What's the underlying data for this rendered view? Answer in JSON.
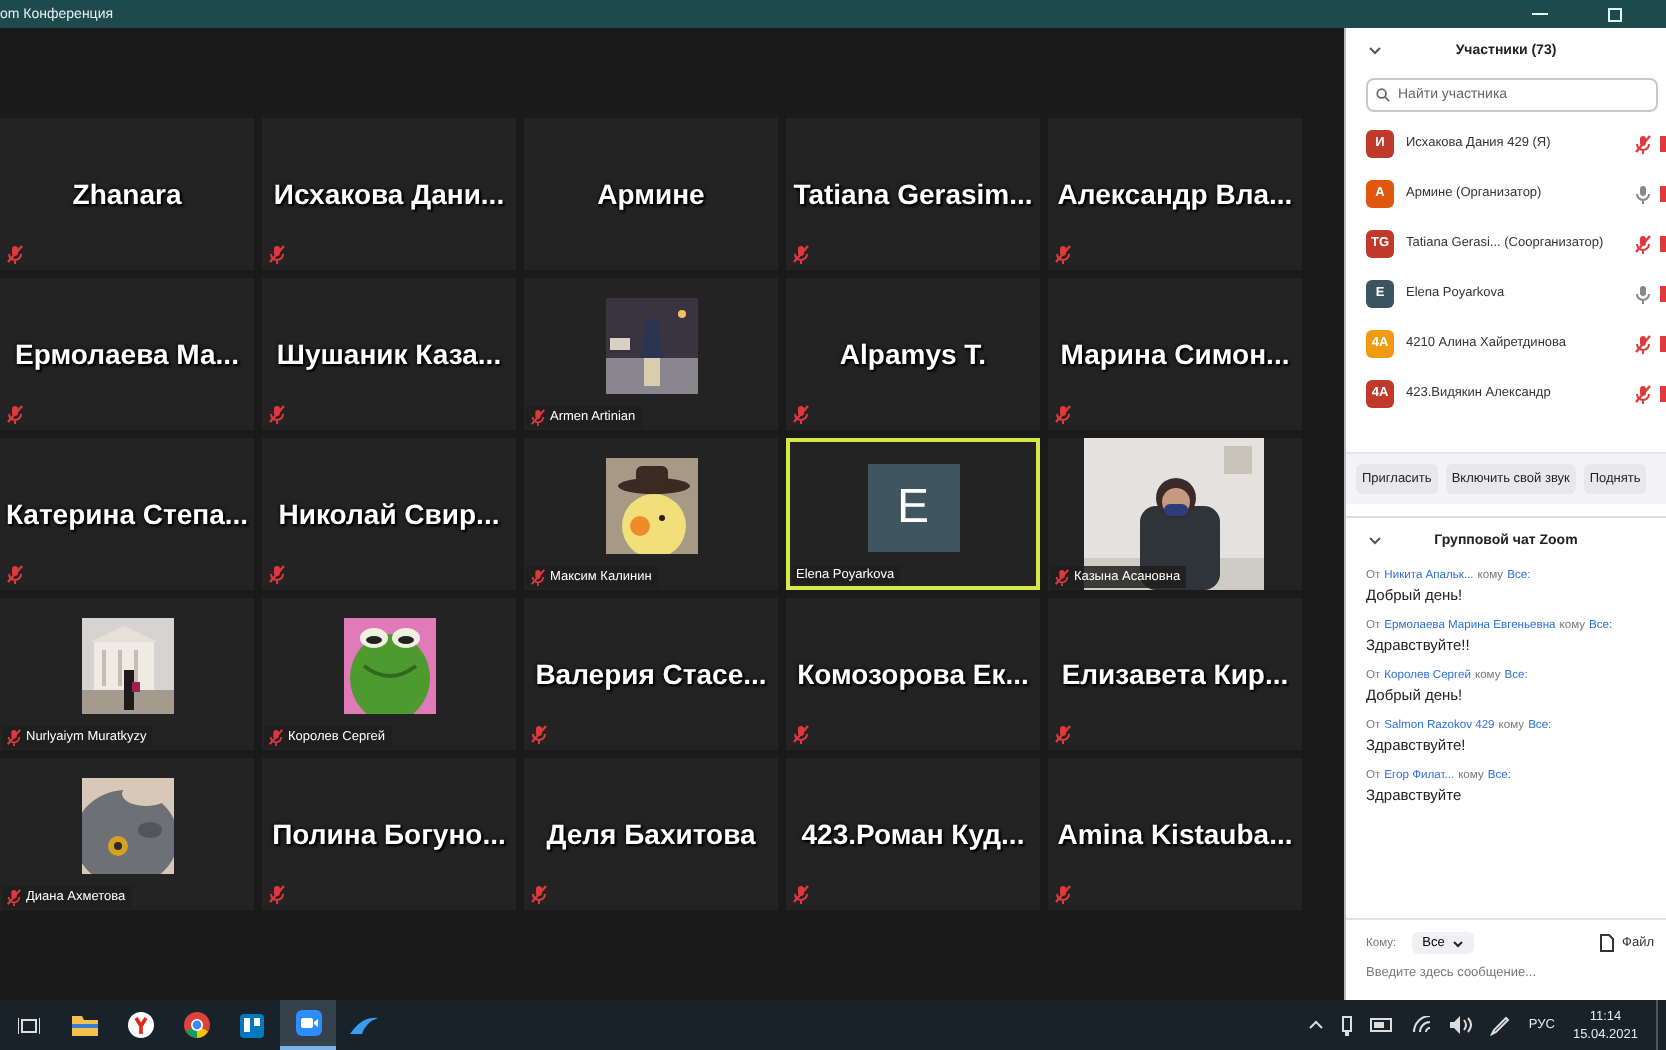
{
  "window": {
    "title": "om Конференция"
  },
  "tiles": [
    {
      "kind": "name",
      "name": "Zhanara",
      "muted": true,
      "active": false
    },
    {
      "kind": "name",
      "name": "Исхакова  Дани...",
      "muted": true,
      "active": false
    },
    {
      "kind": "name",
      "name": "Армине",
      "muted": false,
      "active": false
    },
    {
      "kind": "name",
      "name": "Tatiana  Gerasim...",
      "muted": true,
      "active": false
    },
    {
      "kind": "name",
      "name": "Александр  Вла...",
      "muted": true,
      "active": false
    },
    {
      "kind": "name",
      "name": "Ермолаева  Ма...",
      "muted": true,
      "active": false
    },
    {
      "kind": "name",
      "name": "Шушаник  Каза...",
      "muted": true,
      "active": false
    },
    {
      "kind": "picture",
      "name": "Armen Artinian",
      "muted": true,
      "active": false
    },
    {
      "kind": "name",
      "name": "Alpamys T.",
      "muted": true,
      "active": false
    },
    {
      "kind": "name",
      "name": "Марина  Симон...",
      "muted": true,
      "active": false
    },
    {
      "kind": "name",
      "name": "Катерина  Степа...",
      "muted": true,
      "active": false
    },
    {
      "kind": "name",
      "name": "Николай  Свир...",
      "muted": true,
      "active": false
    },
    {
      "kind": "picture",
      "name": "Максим Калинин",
      "muted": true,
      "active": false
    },
    {
      "kind": "avatar",
      "letter": "E",
      "name": "Elena Poyarkova",
      "muted": false,
      "active": true
    },
    {
      "kind": "video",
      "name": "Казына Асановна",
      "muted": true,
      "active": false
    },
    {
      "kind": "picture",
      "name": "Nurlyaiym Muratkyzy",
      "muted": true,
      "active": false
    },
    {
      "kind": "picture",
      "name": "Королев Сергей",
      "muted": true,
      "active": false
    },
    {
      "kind": "name",
      "name": "Валерия  Стасе...",
      "muted": true,
      "active": false
    },
    {
      "kind": "name",
      "name": "Комозорова  Ек...",
      "muted": true,
      "active": false
    },
    {
      "kind": "name",
      "name": "Елизавета  Кир...",
      "muted": true,
      "active": false
    },
    {
      "kind": "picture",
      "name": "Диана Ахметова",
      "muted": true,
      "active": false
    },
    {
      "kind": "name",
      "name": "Полина  Богуно...",
      "muted": true,
      "active": false
    },
    {
      "kind": "name",
      "name": "Деля Бахитова",
      "muted": true,
      "active": false
    },
    {
      "kind": "name",
      "name": "423.Роман  Куд...",
      "muted": true,
      "active": false
    },
    {
      "kind": "name",
      "name": "Amina  Kistauba...",
      "muted": true,
      "active": false
    }
  ],
  "participants": {
    "title": "Участники (73)",
    "search": {
      "placeholder": "Найти участника"
    },
    "items": [
      {
        "initials": "И",
        "color": "#c0392b",
        "name": "Исхакова Дания 429 (Я)",
        "muted": true
      },
      {
        "initials": "А",
        "color": "#e0580f",
        "name": "Армине (Организатор)",
        "muted": false
      },
      {
        "initials": "TG",
        "color": "#c0392b",
        "name": "Tatiana Gerasi...  (Соорганизатор)",
        "muted": true
      },
      {
        "initials": "E",
        "color": "#3b5560",
        "name": "Elena Poyarkova",
        "muted": false
      },
      {
        "initials": "4A",
        "color": "#f29b11",
        "name": "4210 Алина Хайретдинова",
        "muted": true
      },
      {
        "initials": "4A",
        "color": "#c0392b",
        "name": "423.Видякин Александр",
        "muted": true
      }
    ],
    "buttons": [
      "Пригласить",
      "Включить свой звук",
      "Поднять"
    ]
  },
  "chat": {
    "title": "Групповой чат Zoom",
    "messages": [
      {
        "from_label": "От",
        "sender": "Никита Апальк...",
        "to_label": "кому",
        "recipient": "Все:",
        "text": "Добрый день!"
      },
      {
        "from_label": "От",
        "sender": "Ермолаева Марина Евгеньевна",
        "to_label": "кому",
        "recipient": "Все:",
        "text": "Здравствуйте!!"
      },
      {
        "from_label": "От",
        "sender": "Королев Сергей",
        "to_label": "кому",
        "recipient": "Все:",
        "text": "Добрый день!"
      },
      {
        "from_label": "От",
        "sender": "Salmon Razokov 429",
        "to_label": "кому",
        "recipient": "Все:",
        "text": "Здравствуйте!"
      },
      {
        "from_label": "От",
        "sender": "Егор Филат...",
        "to_label": "кому",
        "recipient": "Все:",
        "text": "Здравствуйте"
      }
    ],
    "to_label": "Кому:",
    "to_value": "Все",
    "file_label": "Файл",
    "input": {
      "placeholder": "Введите здесь сообщение..."
    }
  },
  "taskbar": {
    "apps": [
      {
        "selected": false
      },
      {
        "selected": false
      },
      {
        "selected": false
      },
      {
        "selected": false
      },
      {
        "selected": false
      },
      {
        "selected": true
      },
      {
        "selected": false
      }
    ],
    "language": "РУС",
    "time": "11:14",
    "date": "15.04.2021"
  }
}
